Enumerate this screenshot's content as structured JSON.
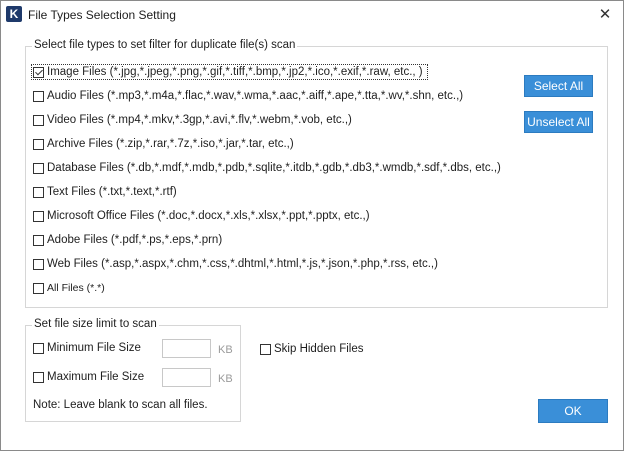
{
  "window": {
    "title": "File Types Selection Setting",
    "app_icon_letter": "K",
    "close_glyph": "✕"
  },
  "types": {
    "legend": "Select file types to set filter for duplicate file(s) scan",
    "items": [
      {
        "label": "Image Files  (*.jpg,*.jpeg,*.png,*.gif,*.tiff,*.bmp,*.jp2,*.ico,*.exif,*.raw, etc., )",
        "checked": true
      },
      {
        "label": "Audio Files (*.mp3,*.m4a,*.flac,*.wav,*.wma,*.aac,*.aiff,*.ape,*.tta,*.wv,*.shn, etc.,)",
        "checked": false
      },
      {
        "label": "Video Files (*.mp4,*.mkv,*.3gp,*.avi,*.flv,*.webm,*.vob, etc.,)",
        "checked": false
      },
      {
        "label": "Archive Files (*.zip,*.rar,*.7z,*.iso,*.jar,*.tar, etc.,)",
        "checked": false
      },
      {
        "label": "Database Files (*.db,*.mdf,*.mdb,*.pdb,*.sqlite,*.itdb,*.gdb,*.db3,*.wmdb,*.sdf,*.dbs, etc.,)",
        "checked": false
      },
      {
        "label": "Text Files (*.txt,*.text,*.rtf)",
        "checked": false
      },
      {
        "label": "Microsoft Office Files (*.doc,*.docx,*.xls,*.xlsx,*.ppt,*.pptx, etc.,)",
        "checked": false
      },
      {
        "label": "Adobe Files (*.pdf,*.ps,*.eps,*.prn)",
        "checked": false
      },
      {
        "label": "Web Files (*.asp,*.aspx,*.chm,*.css,*.dhtml,*.html,*.js,*.json,*.php,*.rss, etc.,)",
        "checked": false
      },
      {
        "label": "All Files (*.*)",
        "checked": false
      }
    ],
    "select_all_label": "Select All",
    "unselect_all_label": "Unselect All"
  },
  "size": {
    "legend": "Set file size limit to scan",
    "min_label": "Minimum File Size",
    "max_label": "Maximum File Size",
    "min_value": "",
    "max_value": "",
    "unit": "KB",
    "note": "Note: Leave blank to scan all files."
  },
  "skip_hidden_label": "Skip Hidden Files",
  "ok_label": "OK",
  "colors": {
    "accent": "#3a8fd8"
  }
}
